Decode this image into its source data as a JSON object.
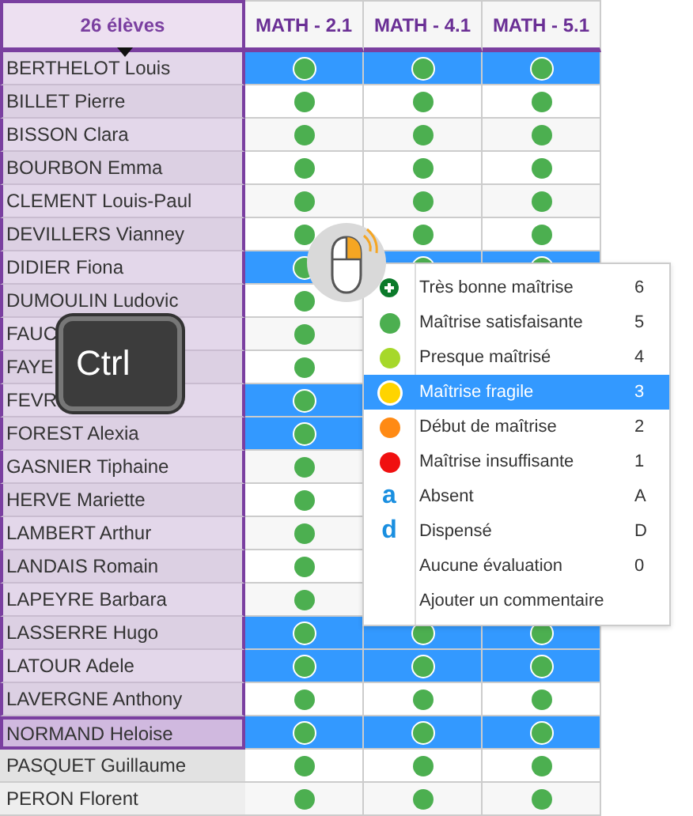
{
  "table": {
    "header": "26 élèves",
    "columns": [
      "MATH - 2.1",
      "MATH - 4.1",
      "MATH - 5.1"
    ],
    "rows": [
      {
        "name": "BERTHELOT Louis",
        "selected": true,
        "focused": false,
        "in_group": true,
        "cells": [
          {
            "color": "#4caf50"
          },
          {
            "color": "#4caf50"
          },
          {
            "color": "#4caf50"
          }
        ]
      },
      {
        "name": "BILLET Pierre",
        "selected": false,
        "focused": false,
        "in_group": true,
        "cells": [
          {
            "color": "#4caf50"
          },
          {
            "color": "#4caf50"
          },
          {
            "color": "#4caf50"
          }
        ]
      },
      {
        "name": "BISSON Clara",
        "selected": false,
        "focused": false,
        "in_group": true,
        "cells": [
          {
            "color": "#4caf50"
          },
          {
            "color": "#4caf50"
          },
          {
            "color": "#4caf50"
          }
        ]
      },
      {
        "name": "BOURBON Emma",
        "selected": false,
        "focused": false,
        "in_group": true,
        "cells": [
          {
            "color": "#4caf50"
          },
          {
            "color": "#4caf50"
          },
          {
            "color": "#4caf50"
          }
        ]
      },
      {
        "name": "CLEMENT Louis-Paul",
        "selected": false,
        "focused": false,
        "in_group": true,
        "cells": [
          {
            "color": "#4caf50"
          },
          {
            "color": "#4caf50"
          },
          {
            "color": "#4caf50"
          }
        ]
      },
      {
        "name": "DEVILLERS Vianney",
        "selected": false,
        "focused": false,
        "in_group": true,
        "cells": [
          {
            "color": "#4caf50"
          },
          {
            "color": "#4caf50"
          },
          {
            "color": "#4caf50"
          }
        ]
      },
      {
        "name": "DIDIER Fiona",
        "selected": true,
        "focused": false,
        "in_group": true,
        "cells": [
          {
            "color": "#4caf50"
          },
          {
            "color": "#4caf50"
          },
          {
            "color": "#4caf50"
          }
        ]
      },
      {
        "name": "DUMOULIN Ludovic",
        "selected": false,
        "focused": false,
        "in_group": true,
        "cells": [
          {
            "color": "#4caf50"
          }
        ]
      },
      {
        "name": "FAUC",
        "selected": false,
        "focused": false,
        "in_group": true,
        "cells": [
          {
            "color": "#4caf50"
          }
        ]
      },
      {
        "name": "FAYE",
        "selected": false,
        "focused": false,
        "in_group": true,
        "cells": [
          {
            "color": "#4caf50"
          }
        ]
      },
      {
        "name": "FEVR",
        "selected": true,
        "focused": false,
        "in_group": true,
        "cells": [
          {
            "color": "#4caf50"
          }
        ]
      },
      {
        "name": "FOREST Alexia",
        "selected": true,
        "focused": false,
        "in_group": true,
        "cells": [
          {
            "color": "#4caf50"
          }
        ]
      },
      {
        "name": "GASNIER Tiphaine",
        "selected": false,
        "focused": false,
        "in_group": true,
        "cells": [
          {
            "color": "#4caf50"
          }
        ]
      },
      {
        "name": "HERVE Mariette",
        "selected": false,
        "focused": false,
        "in_group": true,
        "cells": [
          {
            "color": "#4caf50"
          }
        ]
      },
      {
        "name": "LAMBERT Arthur",
        "selected": false,
        "focused": false,
        "in_group": true,
        "cells": [
          {
            "color": "#4caf50"
          }
        ]
      },
      {
        "name": "LANDAIS Romain",
        "selected": false,
        "focused": false,
        "in_group": true,
        "cells": [
          {
            "color": "#4caf50"
          }
        ]
      },
      {
        "name": "LAPEYRE Barbara",
        "selected": false,
        "focused": false,
        "in_group": true,
        "cells": [
          {
            "color": "#4caf50"
          }
        ]
      },
      {
        "name": "LASSERRE Hugo",
        "selected": true,
        "focused": false,
        "in_group": true,
        "cells": [
          {
            "color": "#4caf50"
          },
          {
            "color": "#4caf50"
          },
          {
            "color": "#4caf50"
          }
        ]
      },
      {
        "name": "LATOUR Adele",
        "selected": true,
        "focused": false,
        "in_group": true,
        "cells": [
          {
            "color": "#4caf50"
          },
          {
            "color": "#4caf50"
          },
          {
            "color": "#4caf50"
          }
        ]
      },
      {
        "name": "LAVERGNE Anthony",
        "selected": false,
        "focused": false,
        "in_group": true,
        "cells": [
          {
            "color": "#4caf50"
          },
          {
            "color": "#4caf50"
          },
          {
            "color": "#4caf50"
          }
        ]
      },
      {
        "name": "NORMAND Heloise",
        "selected": true,
        "focused": true,
        "in_group": true,
        "cells": [
          {
            "color": "#4caf50"
          },
          {
            "color": "#4caf50"
          },
          {
            "color": "#4caf50"
          }
        ]
      },
      {
        "name": "PASQUET Guillaume",
        "selected": false,
        "focused": false,
        "in_group": false,
        "cells": [
          {
            "color": "#4caf50"
          },
          {
            "color": "#4caf50"
          },
          {
            "color": "#4caf50"
          }
        ]
      },
      {
        "name": "PERON Florent",
        "selected": false,
        "focused": false,
        "in_group": false,
        "cells": [
          {
            "color": "#4caf50"
          },
          {
            "color": "#4caf50"
          },
          {
            "color": "#4caf50"
          }
        ]
      }
    ]
  },
  "context_menu": {
    "items": [
      {
        "kind": "plus",
        "label": "Très bonne maîtrise",
        "shortcut": "6",
        "selected": false
      },
      {
        "kind": "dot",
        "color": "#4caf50",
        "label": "Maîtrise satisfaisante",
        "shortcut": "5",
        "selected": false
      },
      {
        "kind": "dot",
        "color": "#a6d82a",
        "label": "Presque maîtrisé",
        "shortcut": "4",
        "selected": false
      },
      {
        "kind": "dot",
        "color": "#ffd400",
        "label": "Maîtrise fragile",
        "shortcut": "3",
        "selected": true
      },
      {
        "kind": "dot",
        "color": "#ff8a14",
        "label": "Début de maîtrise",
        "shortcut": "2",
        "selected": false
      },
      {
        "kind": "dot",
        "color": "#f01010",
        "label": "Maîtrise insuffisante",
        "shortcut": "1",
        "selected": false
      },
      {
        "kind": "glyph",
        "glyph": "a",
        "label": "Absent",
        "shortcut": "A",
        "selected": false
      },
      {
        "kind": "glyph",
        "glyph": "d",
        "label": "Dispensé",
        "shortcut": "D",
        "selected": false
      },
      {
        "kind": "none",
        "label": "Aucune évaluation",
        "shortcut": "0",
        "selected": false
      },
      {
        "kind": "none",
        "label": "Ajouter un commentaire",
        "selected": false
      }
    ]
  },
  "key_overlay": {
    "label": "Ctrl"
  }
}
